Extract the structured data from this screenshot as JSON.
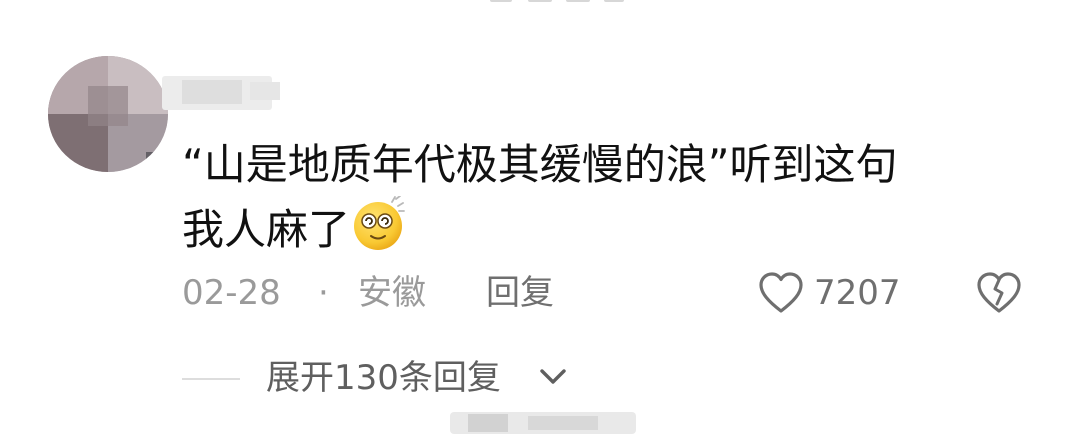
{
  "comment": {
    "text_line1": "“山是地质年代极其缓慢的浪”听到这句",
    "text_line2": "我人麻了",
    "emoji": "dizzy-face-emoji",
    "date": "02-28",
    "separator": "·",
    "location": "安徽",
    "reply_label": "回复",
    "like_count": "7207",
    "icons": {
      "like": "heart-outline-icon",
      "dislike": "broken-heart-icon",
      "expand": "chevron-down-icon"
    }
  },
  "replies": {
    "expand_label": "展开130条回复"
  },
  "colors": {
    "text_primary": "#111111",
    "text_meta": "#9a9a9a",
    "text_action": "#6f6f6f",
    "emoji_yellow": "#f9c933",
    "divider": "#dddddd"
  }
}
